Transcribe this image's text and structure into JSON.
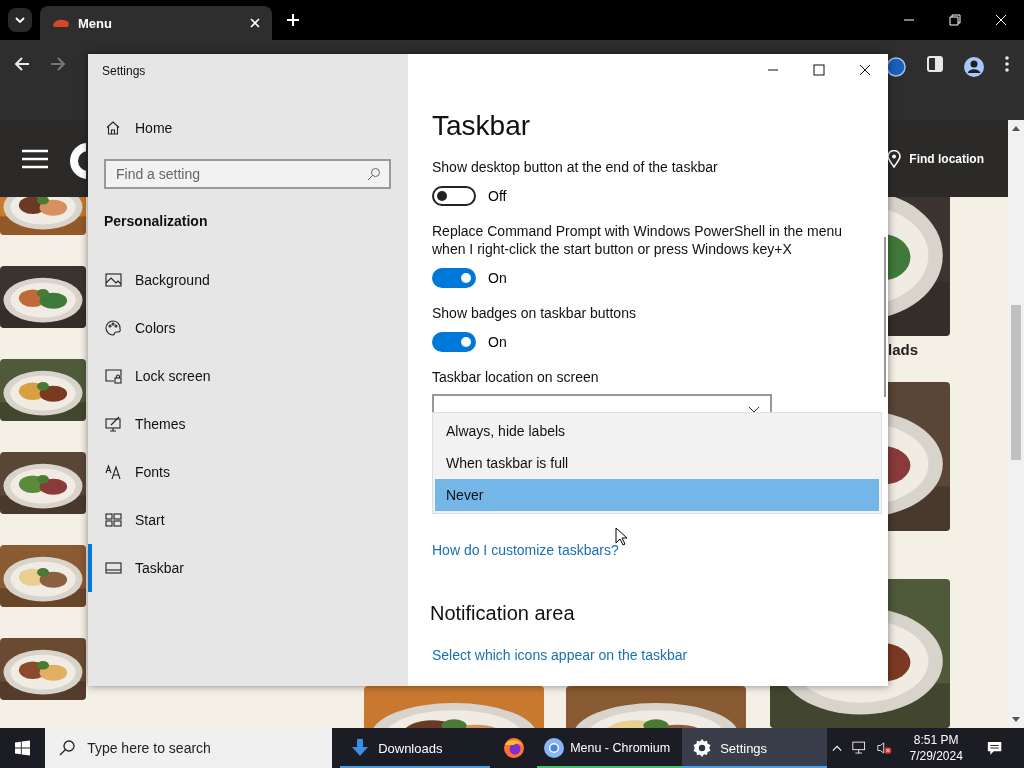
{
  "browser": {
    "tabs": [
      {
        "title": "Menu",
        "selected": true
      }
    ],
    "web": {
      "find_location": "Find location",
      "heading_fragment": "lads"
    }
  },
  "settings": {
    "title": "Settings",
    "home": "Home",
    "search": {
      "placeholder": "Find a setting"
    },
    "section": "Personalization",
    "nav": [
      {
        "kind": "background",
        "label": "Background",
        "selected": false
      },
      {
        "kind": "colors",
        "label": "Colors",
        "selected": false
      },
      {
        "kind": "lock",
        "label": "Lock screen",
        "selected": false
      },
      {
        "kind": "themes",
        "label": "Themes",
        "selected": false
      },
      {
        "kind": "fonts",
        "label": "Fonts",
        "selected": false
      },
      {
        "kind": "start",
        "label": "Start",
        "selected": false
      },
      {
        "kind": "taskbar",
        "label": "Taskbar",
        "selected": true
      }
    ],
    "page_title": "Taskbar",
    "options": [
      {
        "kind": "toggle",
        "label": "Show desktop button at the end of the taskbar",
        "on": false,
        "state": "Off"
      },
      {
        "kind": "toggle",
        "label": "Replace Command Prompt with Windows PowerShell in the menu when I right-click the start button or press Windows key+X",
        "on": true,
        "state": "On"
      },
      {
        "kind": "toggle",
        "label": "Show badges on taskbar buttons",
        "on": true,
        "state": "On"
      },
      {
        "kind": "dropdown",
        "label": "Taskbar location on screen"
      }
    ],
    "popup": [
      {
        "label": "Always, hide labels",
        "selected": false
      },
      {
        "label": "When taskbar is full",
        "selected": false
      },
      {
        "label": "Never",
        "selected": true
      }
    ],
    "help_link": "How do I customize taskbars?",
    "notification_heading": "Notification area",
    "notification_link": "Select which icons appear on the taskbar"
  },
  "taskbar": {
    "search_placeholder": "Type here to search",
    "apps": [
      {
        "kind": "downloads",
        "label": "Downloads",
        "active": false,
        "color": "#4aa0e6"
      },
      {
        "kind": "firefox",
        "active": false
      },
      {
        "kind": "chromium",
        "label": "Menu - Chromium",
        "active": false,
        "color": "#3ec46d"
      },
      {
        "kind": "settings",
        "label": "Settings",
        "active": true,
        "color": "#4aa0e6"
      }
    ],
    "time": "8:51 PM",
    "date": "7/29/2024"
  }
}
